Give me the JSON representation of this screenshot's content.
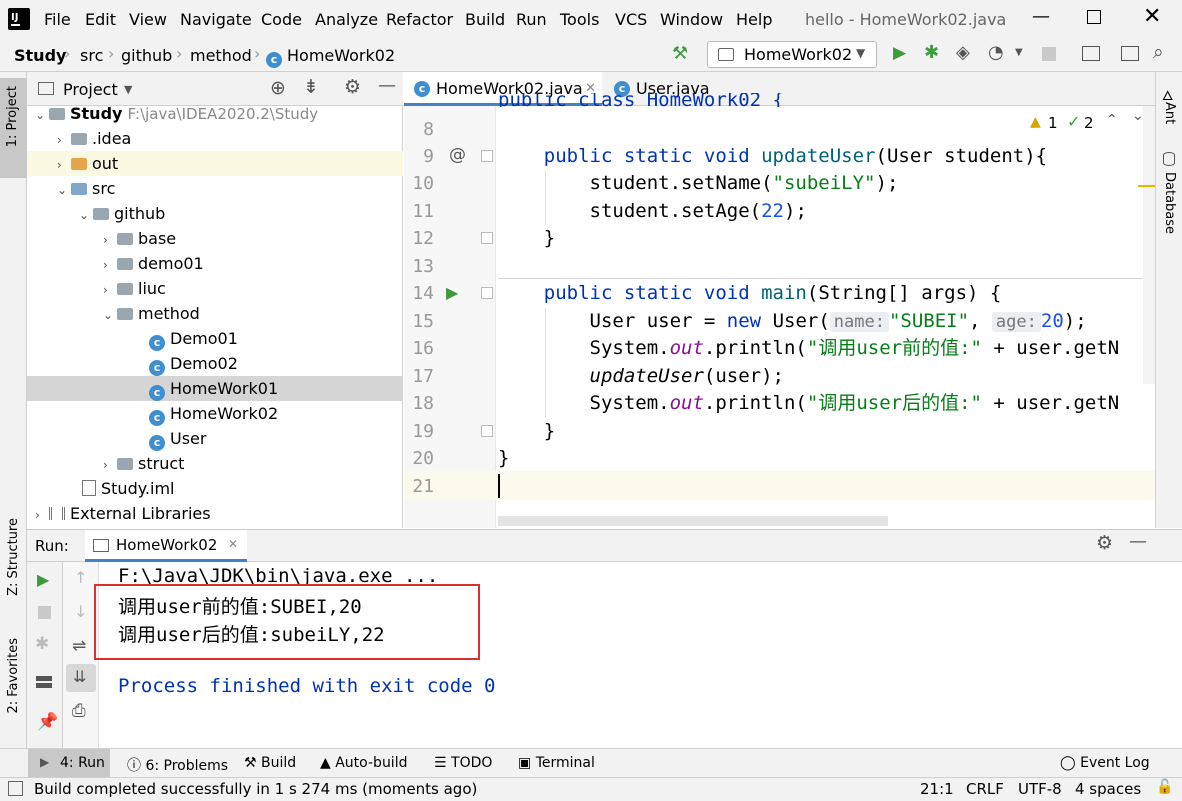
{
  "menu": [
    "File",
    "Edit",
    "View",
    "Navigate",
    "Code",
    "Analyze",
    "Refactor",
    "Build",
    "Run",
    "Tools",
    "VCS",
    "Window",
    "Help"
  ],
  "window_title": "hello - HomeWork02.java",
  "breadcrumbs": [
    "Study",
    "src",
    "github",
    "method",
    "HomeWork02"
  ],
  "run_config": "HomeWork02",
  "left_strip": {
    "project": "1: Project",
    "structure": "Z: Structure",
    "favorites": "2: Favorites"
  },
  "right_strip": {
    "ant": "Ant",
    "database": "Database"
  },
  "project_panel": {
    "title": "Project",
    "tree": [
      {
        "label": "Study",
        "extra": "F:\\java\\IDEA2020.2\\Study"
      },
      {
        "label": ".idea"
      },
      {
        "label": "out"
      },
      {
        "label": "src"
      },
      {
        "label": "github"
      },
      {
        "label": "base"
      },
      {
        "label": "demo01"
      },
      {
        "label": "liuc"
      },
      {
        "label": "method"
      },
      {
        "label": "Demo01"
      },
      {
        "label": "Demo02"
      },
      {
        "label": "HomeWork01"
      },
      {
        "label": "HomeWork02"
      },
      {
        "label": "User"
      },
      {
        "label": "struct"
      },
      {
        "label": "Study.iml"
      },
      {
        "label": "External Libraries"
      }
    ]
  },
  "editor": {
    "tabs": [
      "HomeWork02.java",
      "User.java"
    ],
    "inspections": {
      "warnings": "1",
      "typos": "2"
    },
    "line_numbers": [
      "8",
      "9",
      "10",
      "11",
      "12",
      "13",
      "14",
      "15",
      "16",
      "17",
      "18",
      "19",
      "20",
      "21"
    ],
    "code": {
      "l9_kw": "public static void ",
      "l9_fn": "updateUser",
      "l9_rest": "(User student){",
      "l10_a": "student.setName(",
      "l10_s": "\"subeiLY\"",
      "l10_b": ");",
      "l11_a": "student.setAge(",
      "l11_n": "22",
      "l11_b": ");",
      "l12": "}",
      "l14_kw": "public static void ",
      "l14_fn": "main",
      "l14_rest": "(String[] args) {",
      "l15_a": "User user = ",
      "l15_kw": "new",
      "l15_b": " User(",
      "l15_h1": "name:",
      "l15_s": "\"SUBEI\"",
      "l15_c": ", ",
      "l15_h2": "age:",
      "l15_n": "20",
      "l15_d": ");",
      "l16_a": "System.",
      "l16_out": "out",
      "l16_b": ".println(",
      "l16_s": "\"调用user前的值:\"",
      "l16_c": " + user.getN",
      "l17": "updateUser",
      "l17_b": "(user);",
      "l18_a": "System.",
      "l18_out": "out",
      "l18_b": ".println(",
      "l18_s": "\"调用user后的值:\"",
      "l18_c": " + user.getN",
      "l19": "}",
      "l20": "}"
    }
  },
  "run_panel": {
    "label": "Run:",
    "tab": "HomeWork02",
    "output": [
      "F:\\Java\\JDK\\bin\\java.exe ...",
      "调用user前的值:SUBEI,20",
      "调用user后的值:subeiLY,22",
      "Process finished with exit code 0"
    ],
    "highlight_color": "#d9302c"
  },
  "bottom_tabs": [
    "4: Run",
    "6: Problems",
    "Build",
    "Auto-build",
    "TODO",
    "Terminal",
    "Event Log"
  ],
  "status": {
    "message": "Build completed successfully in 1 s 274 ms (moments ago)",
    "position": "21:1",
    "line_sep": "CRLF",
    "encoding": "UTF-8",
    "indent": "4 spaces"
  }
}
